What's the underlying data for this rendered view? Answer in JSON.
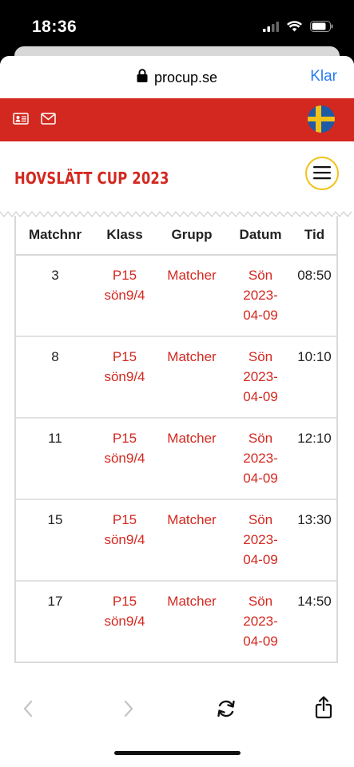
{
  "status_bar": {
    "time": "18:36"
  },
  "browser": {
    "url": "procup.se",
    "done_label": "Klar"
  },
  "site": {
    "title": "HOVSLÄTT CUP 2023"
  },
  "table": {
    "headers": [
      "Matchnr",
      "Klass",
      "Grupp",
      "Datum",
      "Tid"
    ],
    "rows": [
      {
        "matchnr": "3",
        "klass_line1": "P15",
        "klass_line2": "sön9/4",
        "grupp": "Matcher",
        "datum_line1": "Sön",
        "datum_line2": "2023-",
        "datum_line3": "04-09",
        "tid": "08:50"
      },
      {
        "matchnr": "8",
        "klass_line1": "P15",
        "klass_line2": "sön9/4",
        "grupp": "Matcher",
        "datum_line1": "Sön",
        "datum_line2": "2023-",
        "datum_line3": "04-09",
        "tid": "10:10"
      },
      {
        "matchnr": "11",
        "klass_line1": "P15",
        "klass_line2": "sön9/4",
        "grupp": "Matcher",
        "datum_line1": "Sön",
        "datum_line2": "2023-",
        "datum_line3": "04-09",
        "tid": "12:10"
      },
      {
        "matchnr": "15",
        "klass_line1": "P15",
        "klass_line2": "sön9/4",
        "grupp": "Matcher",
        "datum_line1": "Sön",
        "datum_line2": "2023-",
        "datum_line3": "04-09",
        "tid": "13:30"
      },
      {
        "matchnr": "17",
        "klass_line1": "P15",
        "klass_line2": "sön9/4",
        "grupp": "Matcher",
        "datum_line1": "Sön",
        "datum_line2": "2023-",
        "datum_line3": "04-09",
        "tid": "14:50"
      }
    ]
  },
  "colors": {
    "brand_red": "#d3281f",
    "link_blue": "#2a7bf0",
    "accent_yellow": "#f2c21a"
  },
  "icons": {
    "topbar": [
      "contact-card-icon",
      "mail-icon",
      "swedish-flag-icon"
    ],
    "bottom": [
      "back-icon",
      "forward-icon",
      "reload-icon",
      "share-icon"
    ]
  }
}
